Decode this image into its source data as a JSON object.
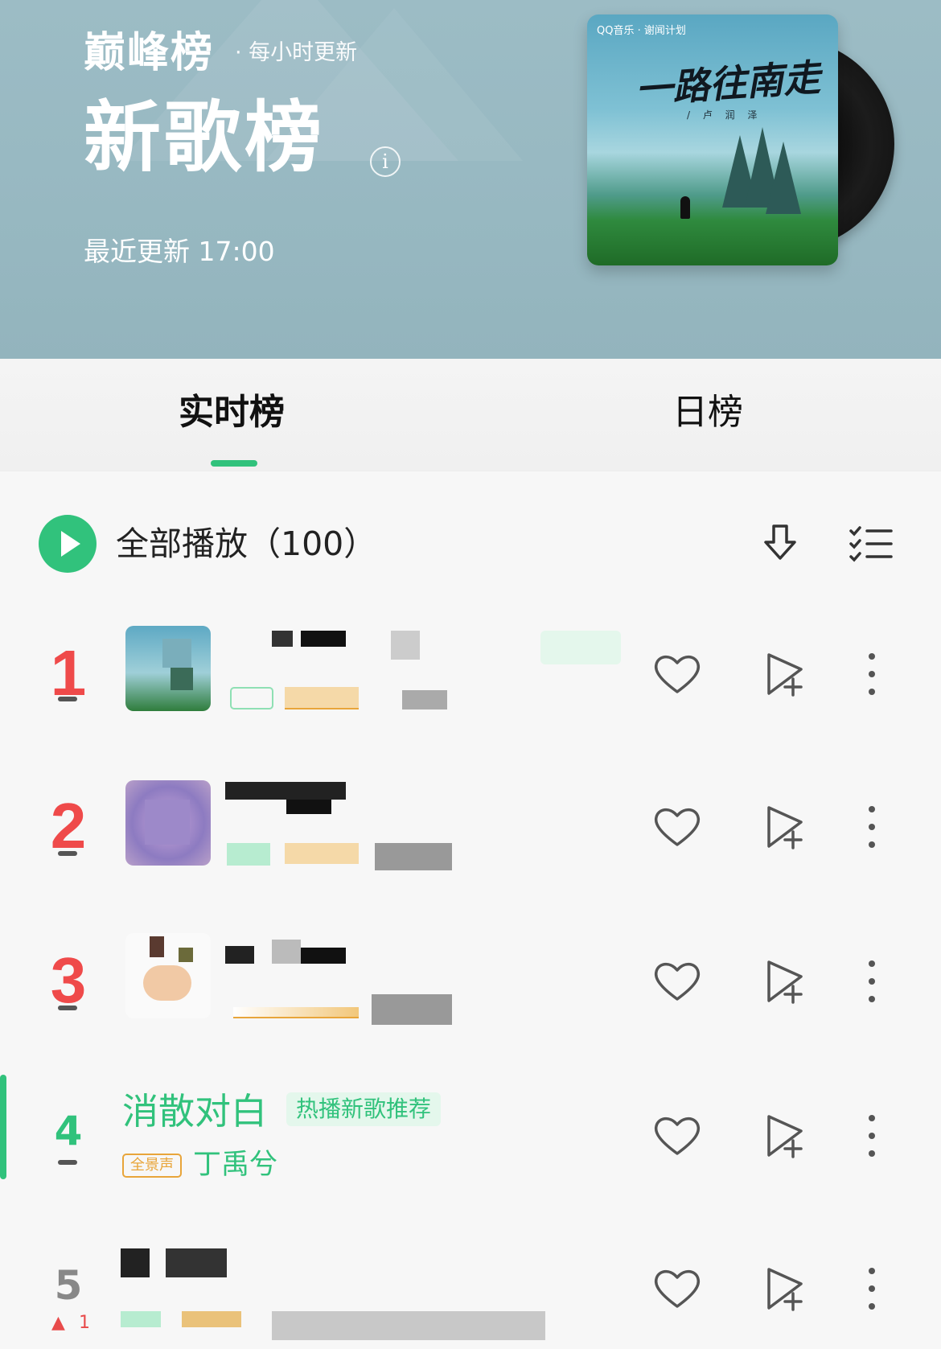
{
  "header": {
    "brand": "巅峰榜",
    "brand_sub": "· 每小时更新",
    "chart_title": "新歌榜",
    "info_icon": "info-icon",
    "updated": "最近更新 17:00",
    "cover": {
      "logo": "QQ音乐 · 谢闻计划",
      "title": "一路往南走",
      "artist": "/ 卢 润 泽"
    }
  },
  "tabs": [
    {
      "label": "实时榜",
      "active": true
    },
    {
      "label": "日榜",
      "active": false
    }
  ],
  "toolbar": {
    "play_all": "全部播放（100）",
    "icons": [
      "download-icon",
      "multi-select-icon"
    ]
  },
  "songs": [
    {
      "rank": "1",
      "trend": "dash"
    },
    {
      "rank": "2",
      "trend": "dash"
    },
    {
      "rank": "3",
      "trend": "dash"
    },
    {
      "rank": "4",
      "trend": "dash",
      "title": "消散对白",
      "tag": "热播新歌推荐",
      "quality": "全景声",
      "artist": "丁禹兮",
      "playing": true
    },
    {
      "rank": "5",
      "trend": "up",
      "trend_value": "1"
    }
  ],
  "actions": [
    "heart-icon",
    "add-to-playlist-icon",
    "more-icon"
  ],
  "colors": {
    "accent": "#31c27c",
    "rank_top": "#ef4a4a",
    "header_bg": "#9cbcc5",
    "quality": "#e8a53a"
  }
}
